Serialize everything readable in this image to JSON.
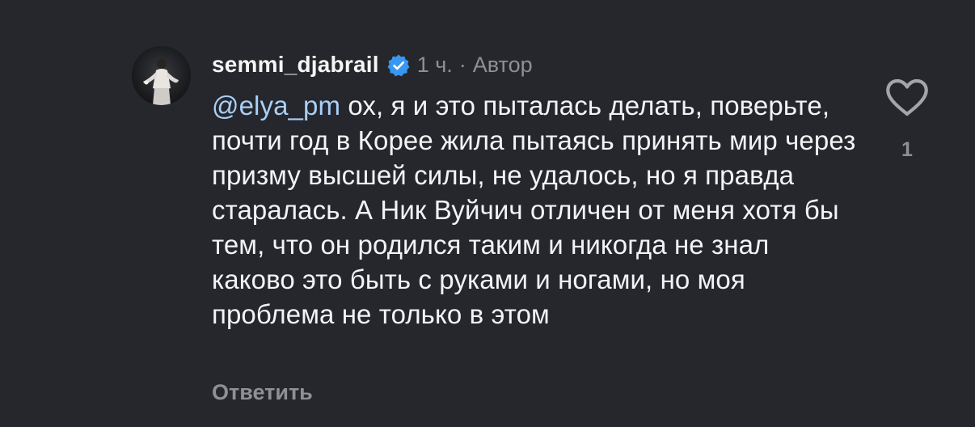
{
  "comment": {
    "author": "semmi_djabrail",
    "time": "1 ч.",
    "separator": "·",
    "author_badge": "Автор",
    "verified_icon": "verified-badge-icon",
    "mention": "@elya_pm",
    "text": " ох, я и это пыталась делать, поверьте, почти год в Корее жила пытаясь принять мир через призму высшей силы, не удалось, но я правда старалась. А Ник Вуйчич отличен от меня хотя бы тем, что он родился таким и никогда не знал каково это быть с руками и ногами, но моя проблема не только в этом",
    "reply_label": "Ответить",
    "like_icon": "heart-outline-icon",
    "like_count": "1"
  },
  "colors": {
    "background": "#25272c",
    "text": "#f2f3f5",
    "secondary": "#8e9096",
    "mention": "#a9cff7",
    "verified": "#3897f0"
  }
}
